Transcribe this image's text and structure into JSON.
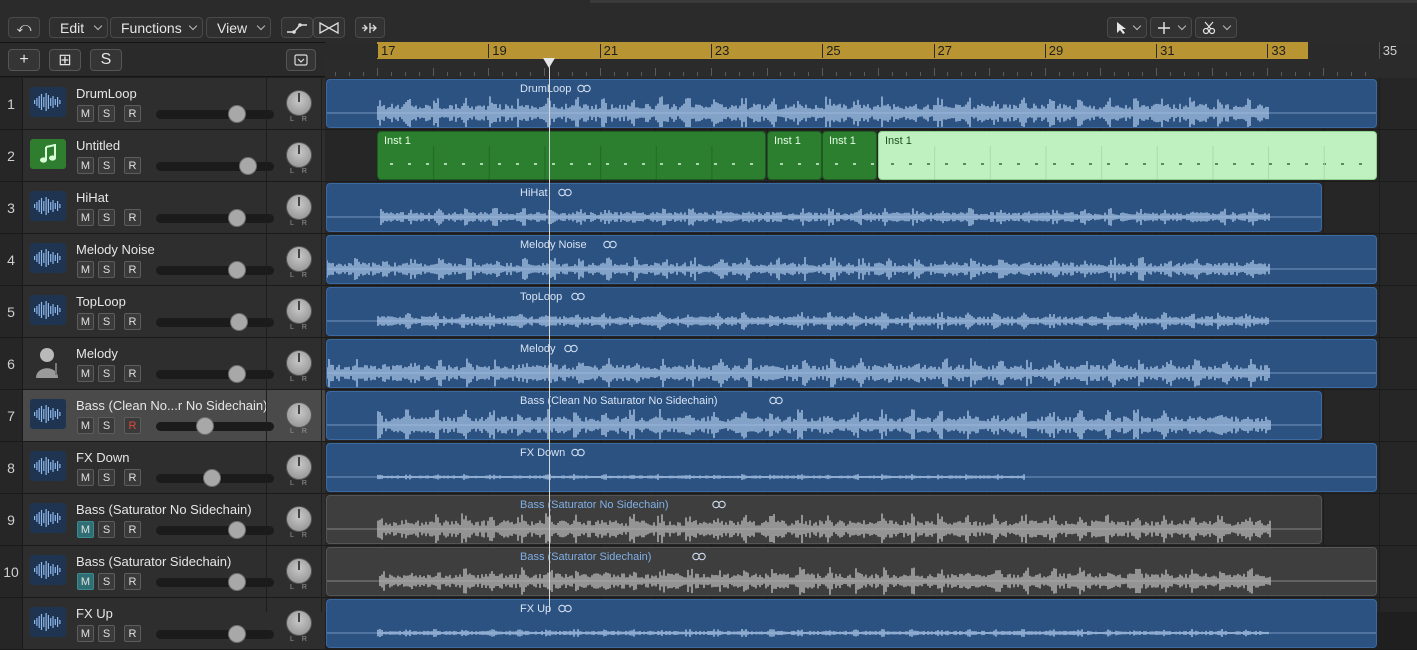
{
  "toolbar": {
    "menus": [
      {
        "label": "Edit"
      },
      {
        "label": "Functions"
      },
      {
        "label": "View"
      }
    ],
    "icons": [
      "back-arrow-icon",
      "automation-curve-icon",
      "flex-icon",
      "catch-playhead-icon",
      "pointer-tool-icon",
      "crosshair-tool-icon",
      "scissors-tool-icon"
    ]
  },
  "header_buttons": {
    "add_label": "+",
    "duplicate_label": "⊞",
    "solo_label": "S"
  },
  "ruler": {
    "inner_bars": [
      "17",
      "19",
      "21",
      "23",
      "25",
      "27",
      "29",
      "31",
      "33"
    ],
    "outer_bars": [
      "35"
    ],
    "cycle_color": "#b89532"
  },
  "tracks": [
    {
      "num": "1",
      "name": "DrumLoop",
      "icon": "waveform-icon",
      "m": "M",
      "s": "S",
      "r": "R",
      "fader": 0.72,
      "selected": false,
      "mute_on": false,
      "rec_on": false
    },
    {
      "num": "2",
      "name": "Untitled",
      "icon": "music-note-icon",
      "m": "M",
      "s": "S",
      "r": "R",
      "fader": 0.83,
      "selected": false,
      "mute_on": false,
      "rec_on": false
    },
    {
      "num": "3",
      "name": "HiHat",
      "icon": "waveform-icon",
      "m": "M",
      "s": "S",
      "r": "R",
      "fader": 0.72,
      "selected": false,
      "mute_on": false,
      "rec_on": false
    },
    {
      "num": "4",
      "name": "Melody Noise",
      "icon": "waveform-icon",
      "m": "M",
      "s": "S",
      "r": "R",
      "fader": 0.72,
      "selected": false,
      "mute_on": false,
      "rec_on": false
    },
    {
      "num": "5",
      "name": "TopLoop",
      "icon": "waveform-icon",
      "m": "M",
      "s": "S",
      "r": "R",
      "fader": 0.74,
      "selected": false,
      "mute_on": false,
      "rec_on": false
    },
    {
      "num": "6",
      "name": "Melody",
      "icon": "person-icon",
      "m": "M",
      "s": "S",
      "r": "R",
      "fader": 0.72,
      "selected": false,
      "mute_on": false,
      "rec_on": false
    },
    {
      "num": "7",
      "name": "Bass (Clean No...r No Sidechain)",
      "icon": "waveform-icon",
      "m": "M",
      "s": "S",
      "r": "R",
      "fader": 0.4,
      "selected": true,
      "mute_on": false,
      "rec_on": true
    },
    {
      "num": "8",
      "name": "FX Down",
      "icon": "waveform-icon",
      "m": "M",
      "s": "S",
      "r": "R",
      "fader": 0.47,
      "selected": false,
      "mute_on": false,
      "rec_on": false
    },
    {
      "num": "9",
      "name": "Bass (Saturator No Sidechain)",
      "icon": "waveform-icon",
      "m": "M",
      "s": "S",
      "r": "R",
      "fader": 0.72,
      "selected": false,
      "mute_on": true,
      "rec_on": false
    },
    {
      "num": "10",
      "name": "Bass (Saturator Sidechain)",
      "icon": "waveform-icon",
      "m": "M",
      "s": "S",
      "r": "R",
      "fader": 0.72,
      "selected": false,
      "mute_on": true,
      "rec_on": false
    },
    {
      "num": "",
      "name": "FX Up",
      "icon": "waveform-icon",
      "m": "M",
      "s": "S",
      "r": "R",
      "fader": 0.72,
      "selected": false,
      "mute_on": false,
      "rec_on": false
    }
  ],
  "regions": [
    {
      "lane": 0,
      "label": "DrumLoop",
      "style": "audio",
      "loop": true
    },
    {
      "lane": 1,
      "label": "Inst 1",
      "style": "green",
      "loop": false
    },
    {
      "lane": 1,
      "label": "Inst 1",
      "style": "green",
      "loop": false
    },
    {
      "lane": 1,
      "label": "Inst 1",
      "style": "green",
      "loop": false
    },
    {
      "lane": 1,
      "label": "Inst 1",
      "style": "lgreen",
      "loop": false
    },
    {
      "lane": 2,
      "label": "HiHat",
      "style": "audio",
      "loop": true
    },
    {
      "lane": 3,
      "label": "Melody Noise",
      "style": "audio",
      "loop": true
    },
    {
      "lane": 4,
      "label": "TopLoop",
      "style": "audio",
      "loop": true
    },
    {
      "lane": 5,
      "label": "Melody",
      "style": "audio",
      "loop": true
    },
    {
      "lane": 6,
      "label": "Bass (Clean No Saturator No Sidechain)",
      "style": "audio",
      "loop": true
    },
    {
      "lane": 7,
      "label": "FX Down",
      "style": "audio",
      "loop": true
    },
    {
      "lane": 8,
      "label": "Bass (Saturator No Sidechain)",
      "style": "gray",
      "loop": true
    },
    {
      "lane": 9,
      "label": "Bass (Saturator Sidechain)",
      "style": "gray",
      "loop": true
    },
    {
      "lane": 10,
      "label": "FX Up",
      "style": "audio",
      "loop": true
    }
  ]
}
